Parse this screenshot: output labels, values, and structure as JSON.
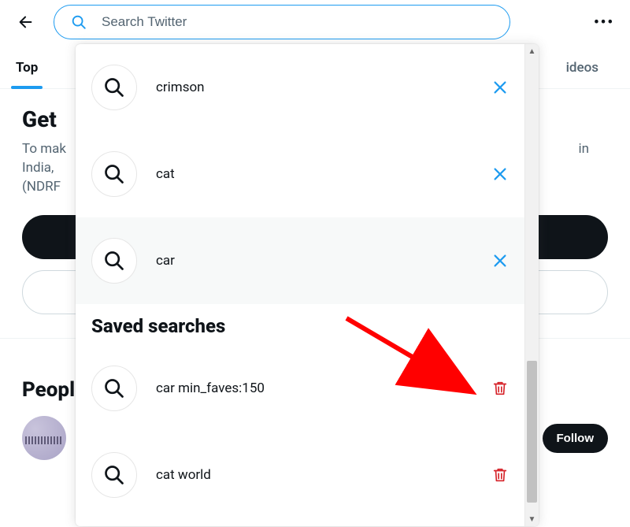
{
  "header": {
    "search_placeholder": "Search Twitter"
  },
  "tabs": {
    "active": "Top",
    "trailing_visible": "ideos"
  },
  "main": {
    "heading_visible": "Get",
    "desc_line1_visible": "To mak",
    "desc_line2_visible": "India,",
    "desc_line3_visible": "(NDRF",
    "desc_trailing": "in"
  },
  "people": {
    "heading_visible": "People",
    "follow_label": "Follow"
  },
  "dropdown": {
    "recent": [
      {
        "label": "crimson"
      },
      {
        "label": "cat"
      },
      {
        "label": "car",
        "hovered": true
      }
    ],
    "saved_heading": "Saved searches",
    "saved": [
      {
        "label": "car min_faves:150"
      },
      {
        "label": "cat world"
      }
    ]
  },
  "colors": {
    "accent": "#1d9bf0",
    "danger": "#e0245e",
    "trash": "#d6232a"
  }
}
